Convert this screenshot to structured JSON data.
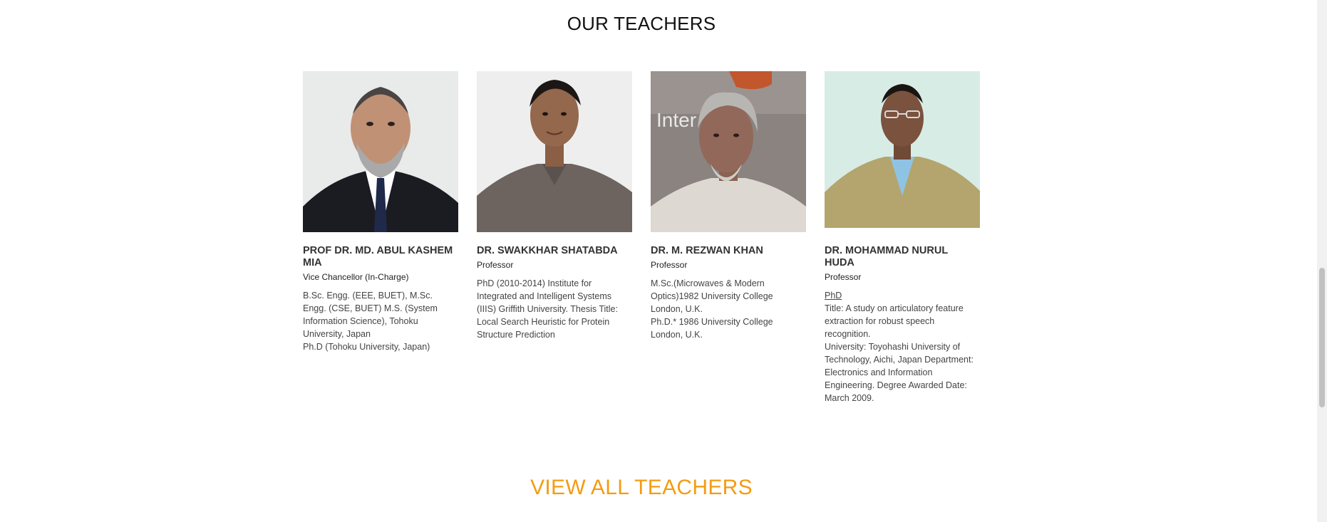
{
  "section": {
    "title": "OUR TEACHERS"
  },
  "teachers": [
    {
      "name": "PROF DR. MD. ABUL KASHEM MIA",
      "title": "Vice Chancellor (In-Charge)",
      "desc": [
        "B.Sc. Engg. (EEE, BUET), M.Sc. Engg. (CSE, BUET) M.S. (System Information Science), Tohoku University, Japan",
        "Ph.D (Tohoku University, Japan)"
      ],
      "photo_alt": "Photo of Prof Dr. Md. Abul Kashem Mia"
    },
    {
      "name": "DR. SWAKKHAR SHATABDA",
      "title": "Professor",
      "desc": [
        "PhD (2010-2014) Institute for Integrated and Intelligent Systems (IIIS) Griffith University. Thesis Title: Local Search Heuristic for Protein Structure Prediction"
      ],
      "photo_alt": "Photo of Dr. Swakkhar Shatabda"
    },
    {
      "name": "DR. M. REZWAN KHAN",
      "title": "Professor",
      "desc": [
        "M.Sc.(Microwaves & Modern Optics)1982 University College London, U.K.",
        "Ph.D.* 1986 University College London, U.K."
      ],
      "photo_alt": "Photo of Dr. M. Rezwan Khan",
      "photo_text": "Inter    al Un"
    },
    {
      "name": "DR. MOHAMMAD NURUL HUDA",
      "title": "Professor",
      "degree_link": "PhD",
      "desc": [
        "Title: A study on articulatory feature extraction for robust speech recognition.",
        "University: Toyohashi University of Technology, Aichi, Japan Department: Electronics and Information Engineering. Degree Awarded Date: March 2009."
      ],
      "photo_alt": "Photo of Dr. Mohammad Nurul Huda"
    }
  ],
  "cta": {
    "label": "VIEW ALL TEACHERS"
  },
  "colors": {
    "accent": "#f39c12",
    "heading": "#111111",
    "text": "#444444"
  }
}
